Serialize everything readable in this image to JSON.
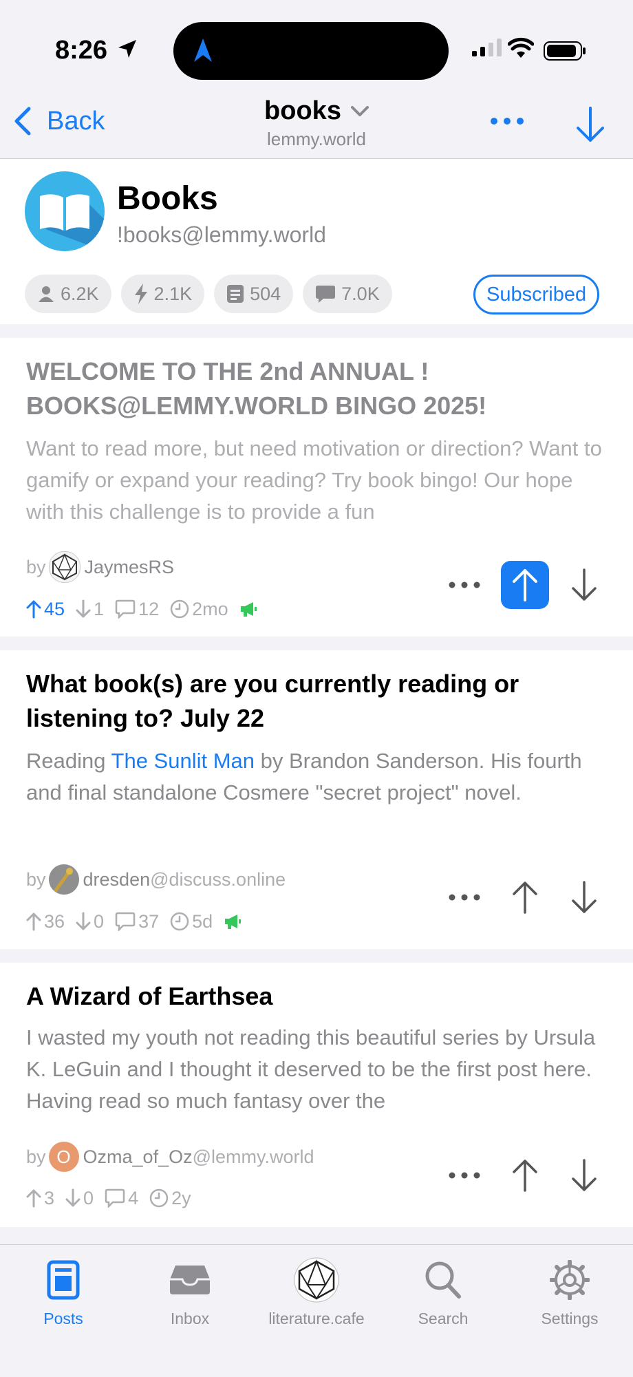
{
  "status_bar": {
    "time": "8:26"
  },
  "nav": {
    "back_label": "Back",
    "title": "books",
    "subtitle": "lemmy.world"
  },
  "community": {
    "name": "Books",
    "handle": "!books@lemmy.world",
    "subscribers": "6.2K",
    "active": "2.1K",
    "posts": "504",
    "comments": "7.0K",
    "subscribe_label": "Subscribed"
  },
  "posts": [
    {
      "title": "WELCOME TO THE 2nd ANNUAL ! BOOKS@LEMMY.WORLD BINGO 2025!",
      "body": "Want to read more, but need motivation or direction? Want to gamify or expand your reading? Try book bingo! Our hope with this challenge is to provide a fun",
      "by": "by",
      "author": "JaymesRS",
      "instance": "",
      "upvotes": "45",
      "downvotes": "1",
      "comments": "12",
      "age": "2mo",
      "read": true,
      "upvoted": true
    },
    {
      "title": "What book(s) are you currently reading or listening to? July 22",
      "body_pre": "Reading ",
      "body_link": "The Sunlit Man",
      "body_post": " by Brandon Sanderson. His fourth and final standalone Cosmere \"secret project\" novel.",
      "by": "by",
      "author": "dresden",
      "instance": "@discuss.online",
      "upvotes": "36",
      "downvotes": "0",
      "comments": "37",
      "age": "5d"
    },
    {
      "title": "A Wizard of Earthsea",
      "body": "I wasted my youth not reading this beautiful series by Ursula K. LeGuin and I thought it deserved to be the first post here. Having read so much fantasy over the",
      "by": "by",
      "author": "Ozma_of_Oz",
      "author_initial": "O",
      "instance": "@lemmy.world",
      "upvotes": "3",
      "downvotes": "0",
      "comments": "4",
      "age": "2y"
    }
  ],
  "tabbar": {
    "posts": "Posts",
    "inbox": "Inbox",
    "account": "literature.cafe",
    "search": "Search",
    "settings": "Settings"
  },
  "colors": {
    "accent": "#1a7cf2",
    "pinned_green": "#34c759"
  }
}
